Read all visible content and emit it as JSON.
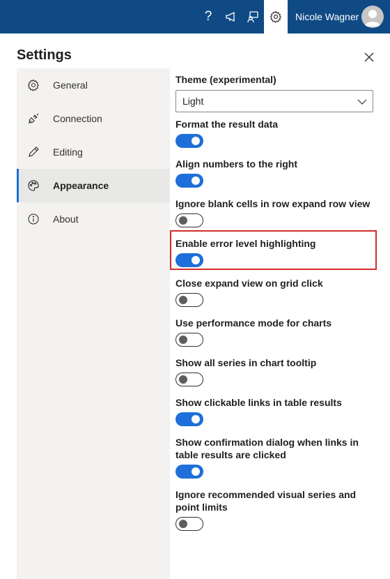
{
  "topbar": {
    "help_icon": "question-mark-icon",
    "announce_icon": "megaphone-icon",
    "feedback_icon": "feedback-icon",
    "settings_icon": "gear-icon",
    "user_name": "Nicole Wagner",
    "avatar_icon": "avatar-icon",
    "help_glyph": "?"
  },
  "panel": {
    "title": "Settings",
    "close_icon": "close-icon"
  },
  "nav": {
    "items": [
      {
        "label": "General",
        "icon": "gear-icon",
        "active": false
      },
      {
        "label": "Connection",
        "icon": "plug-icon",
        "active": false
      },
      {
        "label": "Editing",
        "icon": "pencil-icon",
        "active": false
      },
      {
        "label": "Appearance",
        "icon": "palette-icon",
        "active": true
      },
      {
        "label": "About",
        "icon": "info-icon",
        "active": false
      }
    ]
  },
  "settings": {
    "theme": {
      "label": "Theme (experimental)",
      "value": "Light"
    },
    "toggles": [
      {
        "label": "Format the result data",
        "on": true
      },
      {
        "label": "Align numbers to the right",
        "on": true
      },
      {
        "label": "Ignore blank cells in row expand row view",
        "on": false
      },
      {
        "label": "Enable error level highlighting",
        "on": true,
        "highlighted": true
      },
      {
        "label": "Close expand view on grid click",
        "on": false
      },
      {
        "label": "Use performance mode for charts",
        "on": false
      },
      {
        "label": "Show all series in chart tooltip",
        "on": false
      },
      {
        "label": "Show clickable links in table results",
        "on": true
      },
      {
        "label": "Show confirmation dialog when links in table results are clicked",
        "on": true
      },
      {
        "label": "Ignore recommended visual series and point limits",
        "on": false
      }
    ]
  },
  "colors": {
    "topbar": "#0f4a85",
    "accent": "#1e6fd9",
    "highlight_border": "#d42b2b",
    "nav_bg": "#f3f2f1"
  }
}
